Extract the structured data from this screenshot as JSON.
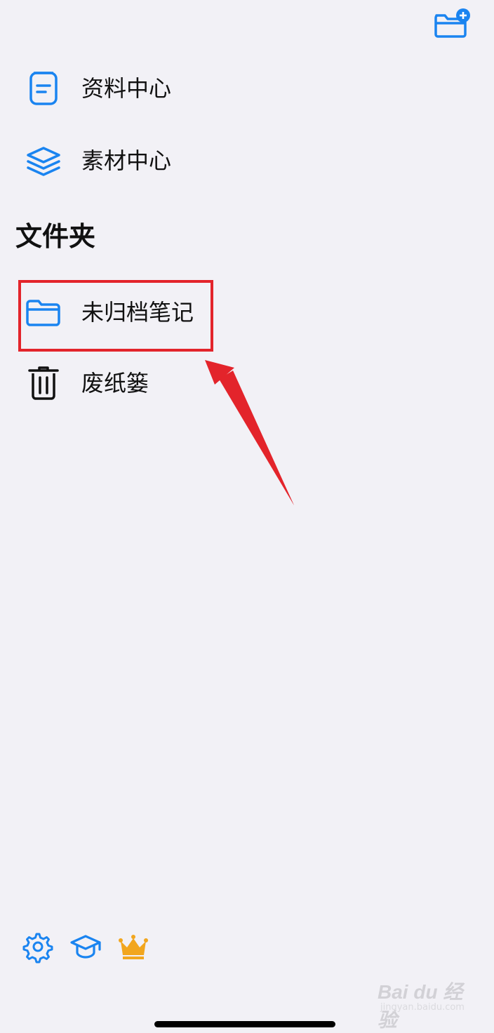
{
  "header": {
    "new_folder_icon": "folder-plus-icon",
    "accent": "#1a84f0"
  },
  "top_items": [
    {
      "label": "资料中心",
      "icon": "document-icon"
    },
    {
      "label": "素材中心",
      "icon": "layers-icon"
    }
  ],
  "folders": {
    "title": "文件夹",
    "items": [
      {
        "label": "未归档笔记",
        "icon": "folder-icon"
      },
      {
        "label": "废纸篓",
        "icon": "trash-icon"
      }
    ]
  },
  "footer": {
    "icons": [
      "gear-icon",
      "graduation-cap-icon",
      "crown-icon"
    ],
    "crown_color": "#f2a61e"
  },
  "annotation": {
    "color": "#e3242b"
  },
  "watermark": {
    "text": "Bai du 经验",
    "sub": "jingyan.baidu.com"
  }
}
